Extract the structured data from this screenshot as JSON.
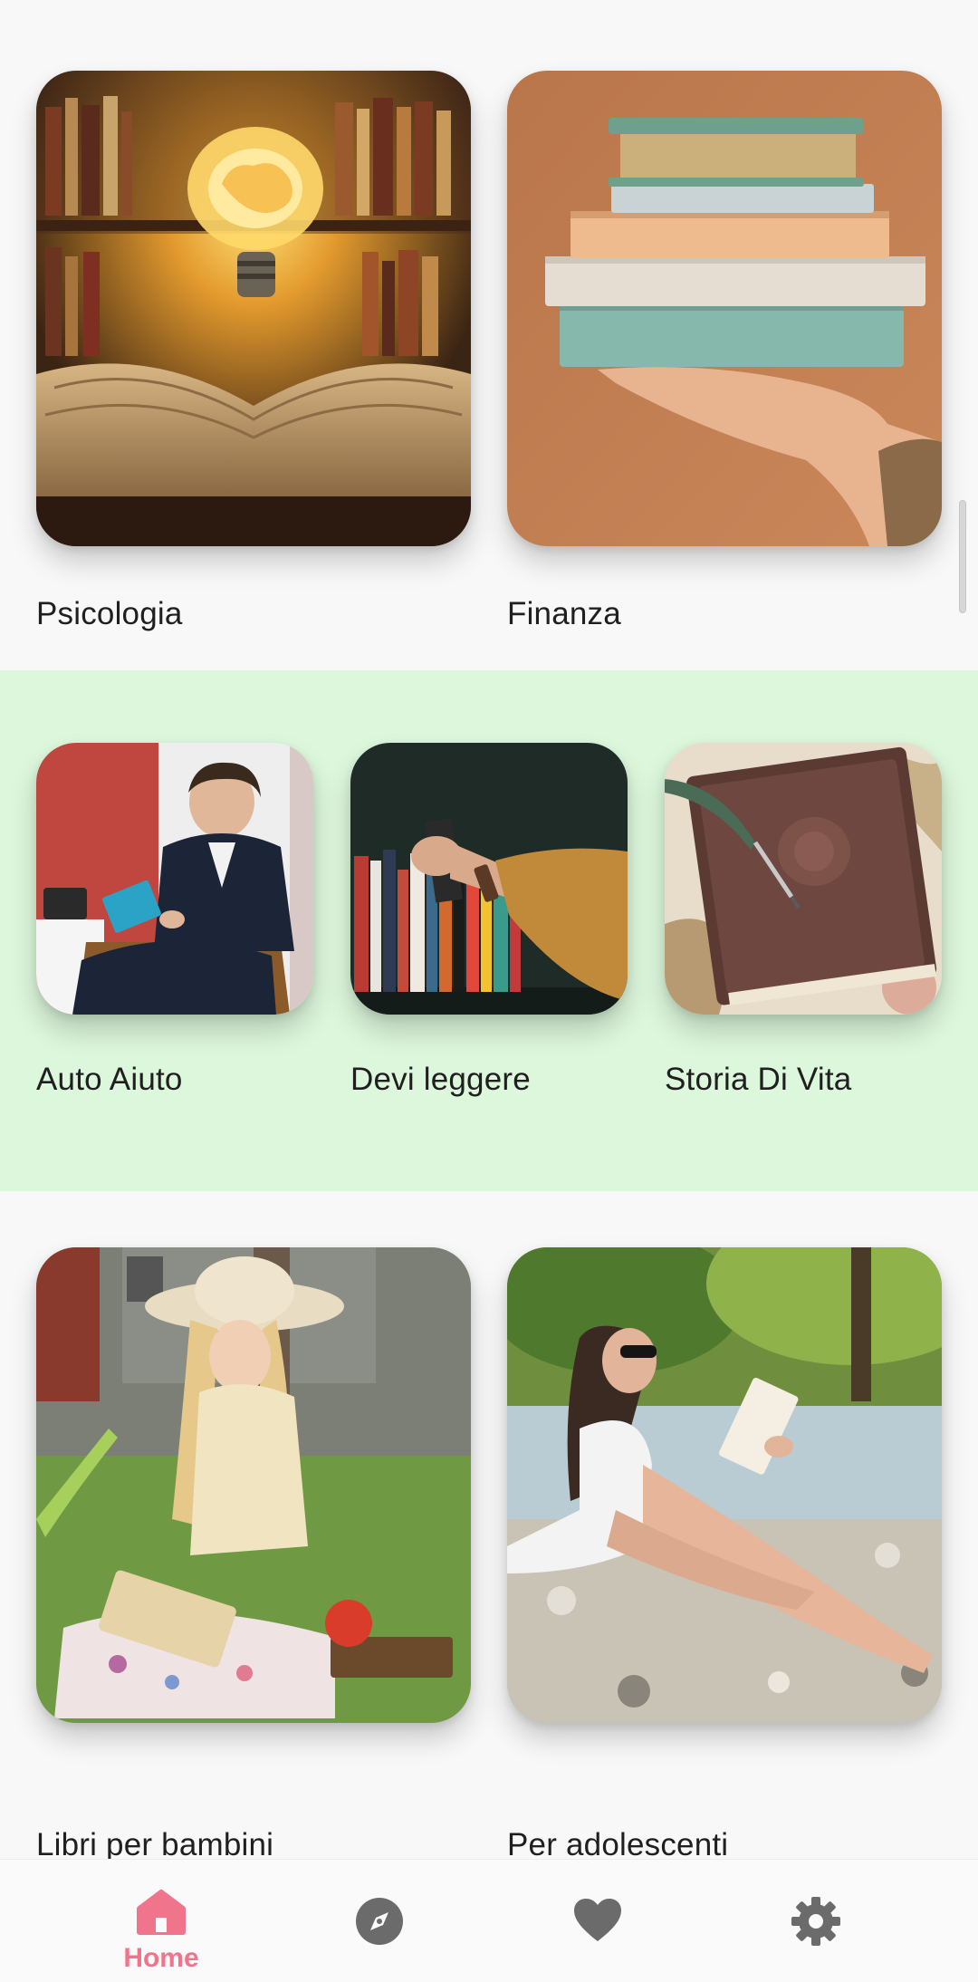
{
  "categories_row1": [
    {
      "label": "Psicologia",
      "image": "open book with glowing brain lightbulb in library"
    },
    {
      "label": "Finanza",
      "image": "hand holding stack of books on brown background"
    }
  ],
  "categories_row2": [
    {
      "label": "Auto Aiuto",
      "image": "man in suit reading book in armchair"
    },
    {
      "label": "Devi leggere",
      "image": "hand pulling book from bookshelf"
    },
    {
      "label": "Storia Di Vita",
      "image": "leather journal with quill pen"
    }
  ],
  "categories_row3": [
    {
      "label": "Libri per bambini",
      "image": "girl in sun hat reading book on grass"
    },
    {
      "label": "Per adolescenti",
      "image": "young woman reading by the river"
    }
  ],
  "bottom_nav": {
    "items": [
      {
        "label": "Home",
        "icon": "home-icon",
        "active": true
      },
      {
        "label": "",
        "icon": "compass-icon",
        "active": false
      },
      {
        "label": "",
        "icon": "heart-icon",
        "active": false
      },
      {
        "label": "",
        "icon": "gear-icon",
        "active": false
      }
    ]
  },
  "colors": {
    "accent": "#f0748c",
    "highlight_section": "#dcf7dc",
    "background": "#f8f8f8",
    "icon_inactive": "#6b6b6b"
  }
}
